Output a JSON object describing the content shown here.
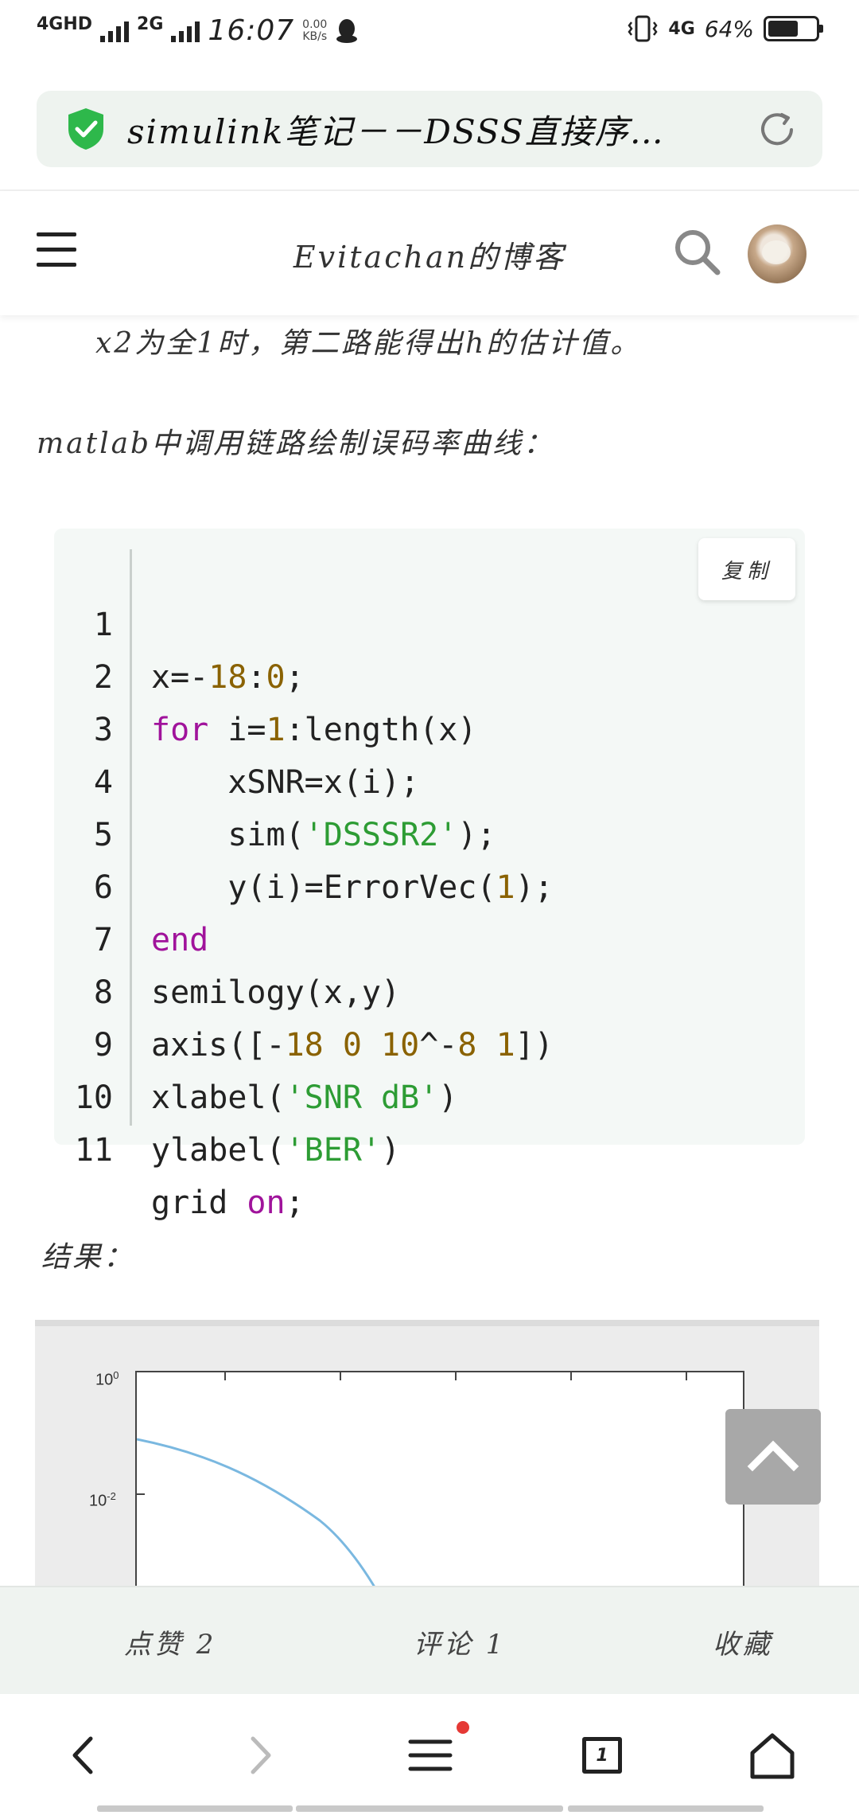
{
  "status_bar": {
    "network1": "4GHD",
    "network2": "2G",
    "time": "16:07",
    "speed_value": "0.00",
    "speed_unit": "KB/s",
    "network_right": "4G",
    "battery_percent": "64%",
    "battery_level": 0.64
  },
  "address_bar": {
    "url_title": "simulink笔记－－DSSS直接序…",
    "secure_icon": "shield-check-icon",
    "reload_icon": "reload-icon"
  },
  "site_header": {
    "title": "Evitachan的博客",
    "menu_icon": "hamburger-menu-icon",
    "search_icon": "search-icon"
  },
  "article": {
    "paragraph1": "x2为全1时，第二路能得出h的估计值。",
    "paragraph2": "matlab中调用链路绘制误码率曲线：",
    "paragraph3": "结果："
  },
  "code_block": {
    "copy_label": "复制",
    "lines": [
      {
        "num": "1"
      },
      {
        "num": "2"
      },
      {
        "num": "3"
      },
      {
        "num": "4"
      },
      {
        "num": "5"
      },
      {
        "num": "6"
      },
      {
        "num": "7"
      },
      {
        "num": "8"
      },
      {
        "num": "9"
      },
      {
        "num": "10"
      },
      {
        "num": "11"
      }
    ],
    "code": {
      "l1_a": "x=-",
      "l1_b": "18",
      "l1_c": ":",
      "l1_d": "0",
      "l1_e": ";",
      "l2_a": "for",
      "l2_b": " i=",
      "l2_c": "1",
      "l2_d": ":length(x)",
      "l3": "    xSNR=x(i);",
      "l4_a": "    sim(",
      "l4_b": "'DSSSR2'",
      "l4_c": ");",
      "l5_a": "    y(i)=ErrorVec(",
      "l5_b": "1",
      "l5_c": ");",
      "l6": "end",
      "l7": "semilogy(x,y)",
      "l8_a": "axis([-",
      "l8_b": "18",
      "l8_c": " ",
      "l8_d": "0",
      "l8_e": " ",
      "l8_f": "10",
      "l8_g": "^-",
      "l8_h": "8",
      "l8_i": " ",
      "l8_j": "1",
      "l8_k": "])",
      "l9_a": "xlabel(",
      "l9_b": "'SNR dB'",
      "l9_c": ")",
      "l10_a": "ylabel(",
      "l10_b": "'BER'",
      "l10_c": ")",
      "l11_a": "grid ",
      "l11_b": "on",
      "l11_c": ";"
    }
  },
  "figure": {
    "ytick_top_base": "10",
    "ytick_top_exp": "0",
    "ytick_mid_base": "10",
    "ytick_mid_exp": "-2",
    "line_color": "#7ab8e0"
  },
  "scroll_top_icon": "chevron-up-icon",
  "action_bar": {
    "like": "点赞 2",
    "comment": "评论 1",
    "favorite": "收藏"
  },
  "browser_nav": {
    "back_icon": "back-arrow-icon",
    "forward_icon": "forward-arrow-icon",
    "menu_icon": "menu-icon",
    "tab_count": "1",
    "home_icon": "home-icon"
  }
}
